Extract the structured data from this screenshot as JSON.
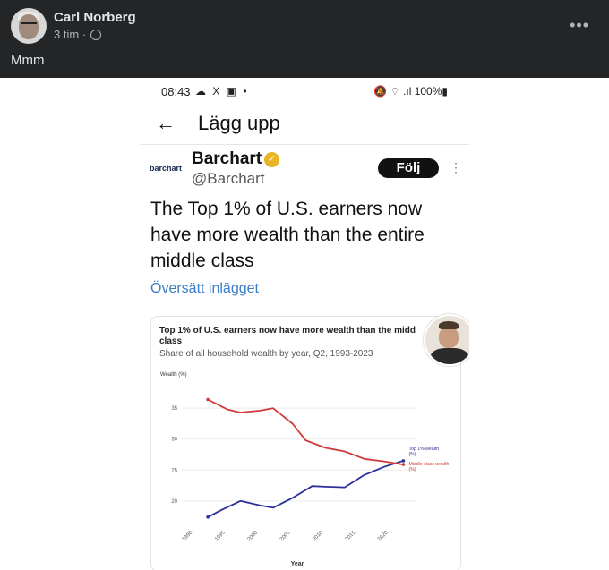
{
  "post": {
    "author": "Carl Norberg",
    "time": "3 tim · ",
    "text": "Mmm",
    "more_icon": "more-dots-icon",
    "privacy_icon": "globe-icon"
  },
  "phone": {
    "status_time": "08:43",
    "status_left_icons": "☁ X ▣ •",
    "status_right": "🔕 ⌔ .ıl 100%▮",
    "screen_title": "Lägg upp",
    "back_icon": "back-arrow-icon"
  },
  "tweet": {
    "logo_text": "barchart",
    "account_name": "Barchart",
    "handle": "@Barchart",
    "follow_label": "Följ",
    "text": "The Top 1% of U.S. earners now have more wealth than the entire middle class",
    "translate_label": "Översätt inlägget"
  },
  "colors": {
    "fb_dark": "#242526",
    "top1": "#2b2f9c",
    "middle": "#d03a3a",
    "link": "#3b7cc4",
    "verified": "#e8b527"
  },
  "chart_data": {
    "type": "line",
    "title": "Top 1% of U.S. earners now have more wealth than the midd class",
    "subtitle": "Share of all household wealth by year, Q2, 1993-2023",
    "ylabel": "Wealth (%)",
    "xlabel": "Year",
    "x_ticks": [
      1990,
      1995,
      2000,
      2005,
      2010,
      2015,
      2020
    ],
    "y_ticks": [
      20,
      25,
      30,
      35
    ],
    "xlim": [
      1989,
      2025
    ],
    "ylim": [
      16.5,
      38.5
    ],
    "grid": true,
    "series": [
      {
        "name": "Top 1% wealth (%)",
        "color": "#2b2f9c",
        "x": [
          1993,
          1995,
          1998,
          2001,
          2003,
          2006,
          2009,
          2011,
          2014,
          2017,
          2020,
          2023
        ],
        "y": [
          17.4,
          18.5,
          20.0,
          19.3,
          18.9,
          20.5,
          22.4,
          22.3,
          22.2,
          24.2,
          25.5,
          26.5
        ]
      },
      {
        "name": "Middle class wealth (%)",
        "color": "#d03a3a",
        "x": [
          1993,
          1996,
          1998,
          2001,
          2003,
          2006,
          2008,
          2011,
          2014,
          2017,
          2020,
          2023
        ],
        "y": [
          36.4,
          34.8,
          34.3,
          34.6,
          35.0,
          32.5,
          29.8,
          28.6,
          28.0,
          26.8,
          26.4,
          25.9
        ]
      }
    ]
  }
}
